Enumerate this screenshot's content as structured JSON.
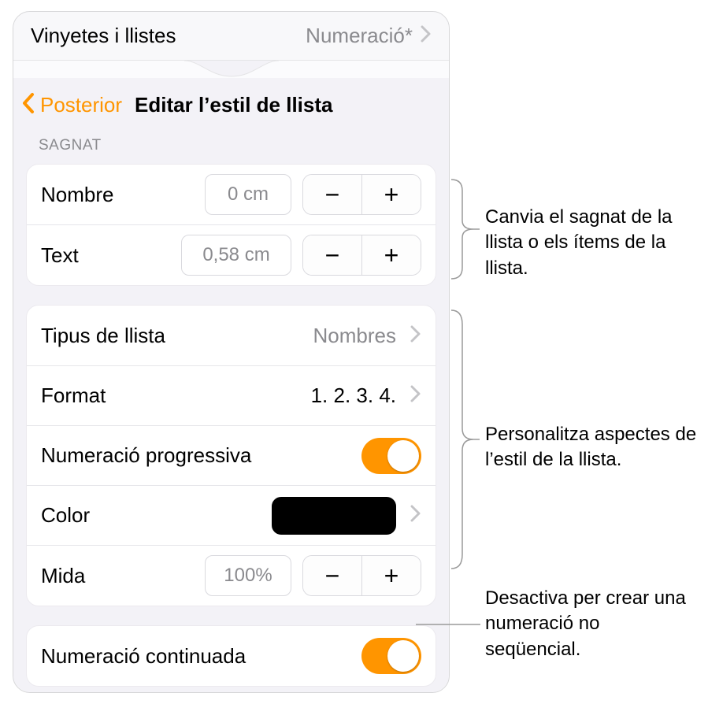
{
  "header": {
    "title": "Vinyetes i llistes",
    "value": "Numeració*"
  },
  "nav": {
    "back": "Posterior",
    "title": "Editar l’estil de llista"
  },
  "sections": {
    "indent_label": "SAGNAT"
  },
  "indent": {
    "number_label": "Nombre",
    "number_value": "0 cm",
    "text_label": "Text",
    "text_value": "0,58 cm"
  },
  "style": {
    "type_label": "Tipus de llista",
    "type_value": "Nombres",
    "format_label": "Format",
    "format_value": "1. 2. 3. 4.",
    "tiered_label": "Numeració progressiva",
    "tiered_on": true,
    "color_label": "Color",
    "color_value": "#000000",
    "size_label": "Mida",
    "size_value": "100%"
  },
  "continue": {
    "label": "Numeració continuada",
    "on": true
  },
  "glyphs": {
    "minus": "−",
    "plus": "+"
  },
  "callouts": {
    "c1": "Canvia el sagnat de la llista o els ítems de la llista.",
    "c2": "Personalitza aspectes de l’estil de la llista.",
    "c3": "Desactiva per crear una numeració no seqüencial."
  }
}
